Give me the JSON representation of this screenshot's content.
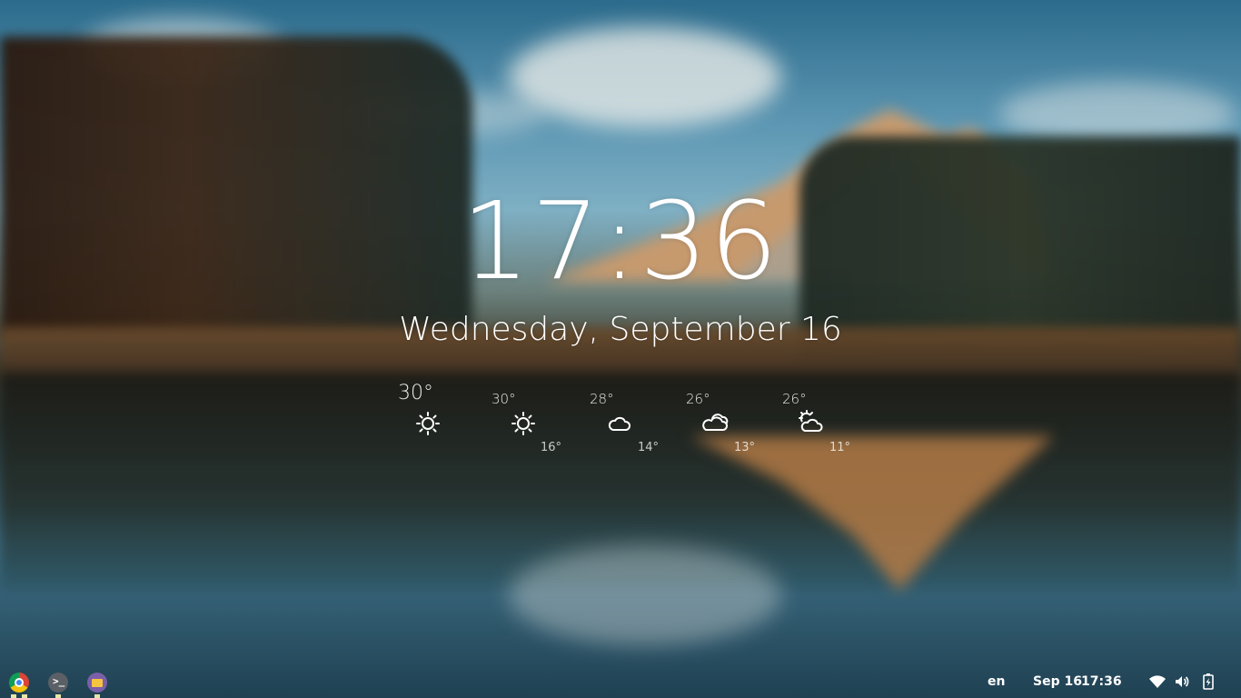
{
  "clock": {
    "hours": "17",
    "colon": ":",
    "minutes": "36"
  },
  "date_line": "Wednesday, September 16",
  "weather": {
    "days": [
      {
        "max": "30°",
        "min": "",
        "icon": "sun-icon"
      },
      {
        "max": "30°",
        "min": "16°",
        "icon": "sun-icon"
      },
      {
        "max": "28°",
        "min": "14°",
        "icon": "cloud-icon"
      },
      {
        "max": "26°",
        "min": "13°",
        "icon": "clouds-icon"
      },
      {
        "max": "26°",
        "min": "11°",
        "icon": "partly-cloudy-icon"
      }
    ]
  },
  "taskbar": {
    "apps": [
      {
        "name": "Chrome",
        "icon": "chrome-icon"
      },
      {
        "name": "Terminal",
        "icon": "terminal-icon"
      },
      {
        "name": "Files",
        "icon": "files-icon"
      }
    ],
    "language": "en",
    "date": "Sep 16",
    "time": "17:36",
    "tray_icons": [
      "wifi-icon",
      "volume-icon",
      "battery-icon"
    ]
  },
  "colors": {
    "text": "#ffffff",
    "indicator": "#e6e6a8"
  }
}
